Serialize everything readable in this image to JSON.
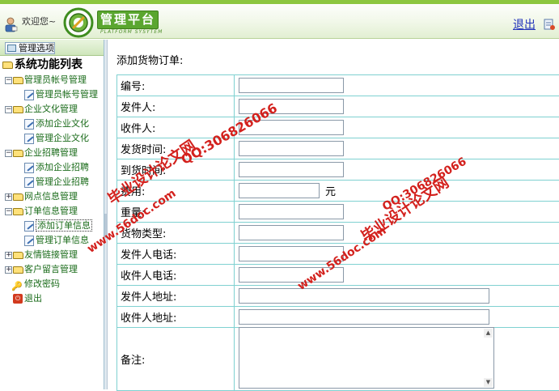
{
  "header": {
    "welcome": "欢迎您~",
    "brand_title": "管理平台",
    "brand_subtitle": "PLATFORM SYSYTEM",
    "logout": "退出"
  },
  "sidebar": {
    "tab_label": "管理选项",
    "root_label": "系统功能列表",
    "groups": [
      {
        "label": "管理员帐号管理",
        "expanded": true,
        "items": [
          "管理员帐号管理"
        ]
      },
      {
        "label": "企业文化管理",
        "expanded": true,
        "items": [
          "添加企业文化",
          "管理企业文化"
        ]
      },
      {
        "label": "企业招聘管理",
        "expanded": true,
        "items": [
          "添加企业招聘",
          "管理企业招聘"
        ]
      },
      {
        "label": "网点信息管理",
        "expanded": false,
        "items": []
      },
      {
        "label": "订单信息管理",
        "expanded": true,
        "items": [
          "添加订单信息",
          "管理订单信息"
        ],
        "selected_item": "添加订单信息"
      },
      {
        "label": "友情链接管理",
        "expanded": false,
        "items": []
      },
      {
        "label": "客户留言管理",
        "expanded": false,
        "items": []
      }
    ],
    "singles": [
      "修改密码",
      "退出"
    ]
  },
  "main": {
    "heading": "添加货物订单:",
    "fields": [
      {
        "label": "编号:",
        "value": ""
      },
      {
        "label": "发件人:",
        "value": ""
      },
      {
        "label": "收件人:",
        "value": ""
      },
      {
        "label": "发货时间:",
        "value": ""
      },
      {
        "label": "到货时间:",
        "value": ""
      },
      {
        "label": "费用:",
        "value": "",
        "unit": "元"
      },
      {
        "label": "重量:",
        "value": ""
      },
      {
        "label": "货物类型:",
        "value": ""
      },
      {
        "label": "发件人电话:",
        "value": ""
      },
      {
        "label": "收件人电话:",
        "value": ""
      },
      {
        "label": "发件人地址:",
        "value": ""
      },
      {
        "label": "收件人地址:",
        "value": ""
      },
      {
        "label": "备注:",
        "value": ""
      }
    ]
  },
  "watermarks": {
    "cn_text": "毕业设计论文网",
    "qq_text": "QQ:306826066",
    "site_text": "www.56doc.com"
  },
  "colors": {
    "accent_green": "#8cc63f",
    "brand_green": "#5aa62f",
    "table_border": "#7fd1d1",
    "watermark_red": "#d3211d",
    "link_blue": "#2233bb"
  }
}
